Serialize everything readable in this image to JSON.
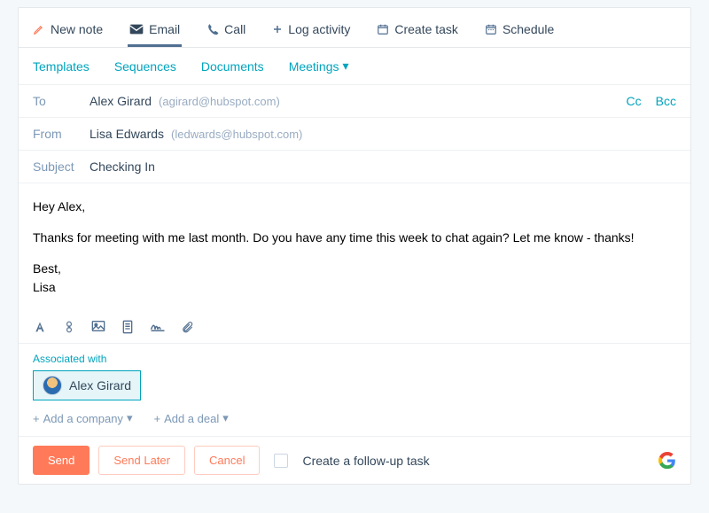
{
  "tabs": {
    "new_note": "New note",
    "email": "Email",
    "call": "Call",
    "log_activity": "Log activity",
    "create_task": "Create task",
    "schedule": "Schedule"
  },
  "sublinks": {
    "templates": "Templates",
    "sequences": "Sequences",
    "documents": "Documents",
    "meetings": "Meetings"
  },
  "fields": {
    "to_label": "To",
    "to_name": "Alex Girard",
    "to_email": "(agirard@hubspot.com)",
    "cc": "Cc",
    "bcc": "Bcc",
    "from_label": "From",
    "from_name": "Lisa Edwards",
    "from_email": "(ledwards@hubspot.com)",
    "subject_label": "Subject",
    "subject_value": "Checking In"
  },
  "body": {
    "greeting": "Hey Alex,",
    "para": "Thanks for meeting with me last month. Do you have any time this week to chat again? Let me know - thanks!",
    "sign1": "Best,",
    "sign2": "Lisa"
  },
  "assoc": {
    "label": "Associated with",
    "chip": "Alex Girard",
    "add_company": "Add a company",
    "add_deal": "Add a deal"
  },
  "footer": {
    "send": "Send",
    "send_later": "Send Later",
    "cancel": "Cancel",
    "follow_up": "Create a follow-up task"
  }
}
